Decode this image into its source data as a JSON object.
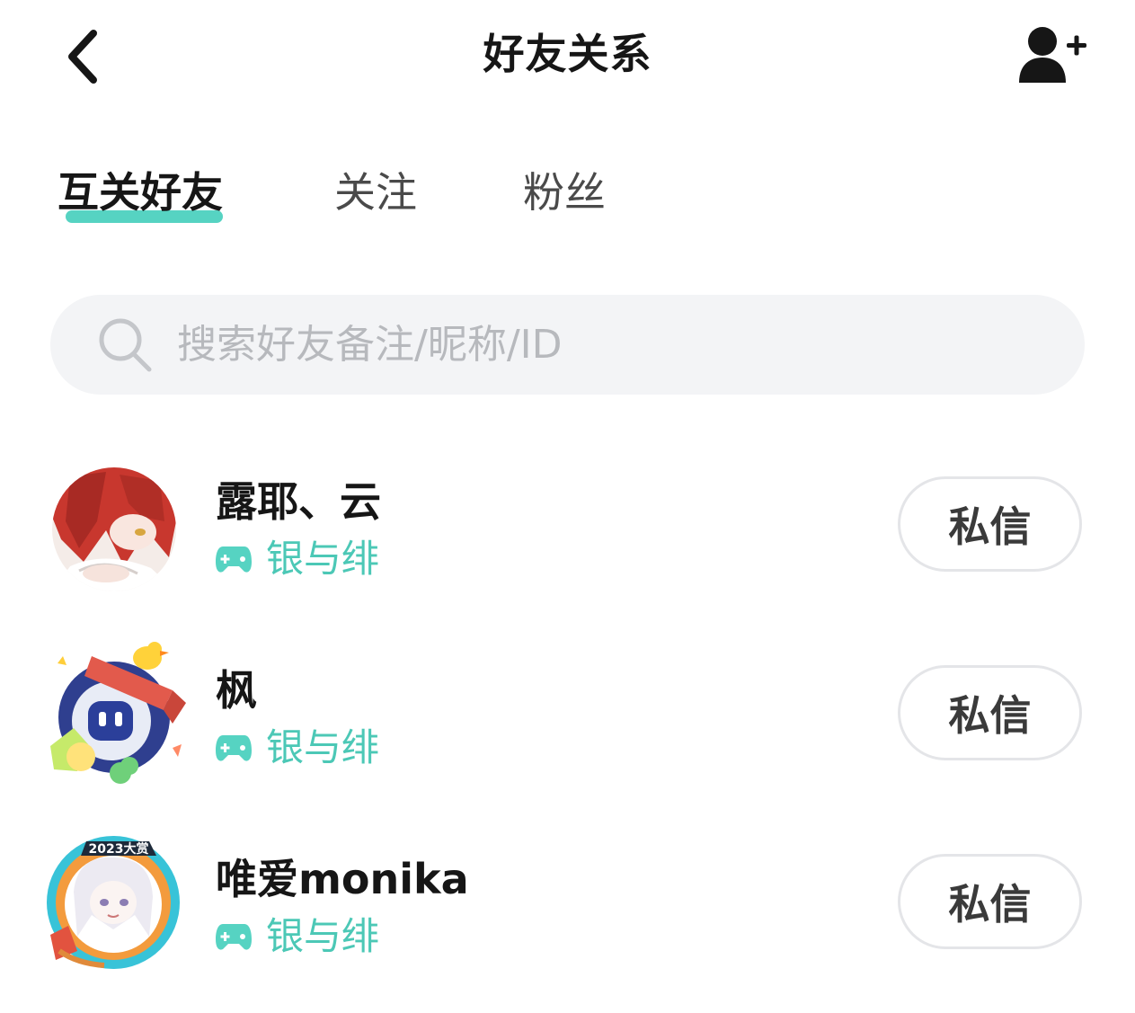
{
  "header": {
    "title": "好友关系",
    "back_icon": "chevron-left-icon",
    "add_friend_icon": "add-user-icon"
  },
  "tabs": [
    {
      "label": "互关好友",
      "active": true
    },
    {
      "label": "关注",
      "active": false
    },
    {
      "label": "粉丝",
      "active": false
    }
  ],
  "search": {
    "placeholder": "搜索好友备注/昵称/ID",
    "icon": "search-icon"
  },
  "friends": [
    {
      "name": "露耶、云",
      "game": "银与绯",
      "action": "私信",
      "avatar": "red-haired-girl-avatar"
    },
    {
      "name": "枫",
      "game": "银与绯",
      "action": "私信",
      "avatar": "win-badge-robot-avatar"
    },
    {
      "name": "唯爱monika",
      "game": "银与绯",
      "action": "私信",
      "avatar": "2023-frame-anime-girl-avatar",
      "avatar_badge_text": "2023大赏"
    }
  ],
  "colors": {
    "accent": "#56d3c2",
    "game_label": "#4cc8b6",
    "search_bg": "#f3f4f6",
    "placeholder": "#b7b9bd"
  }
}
